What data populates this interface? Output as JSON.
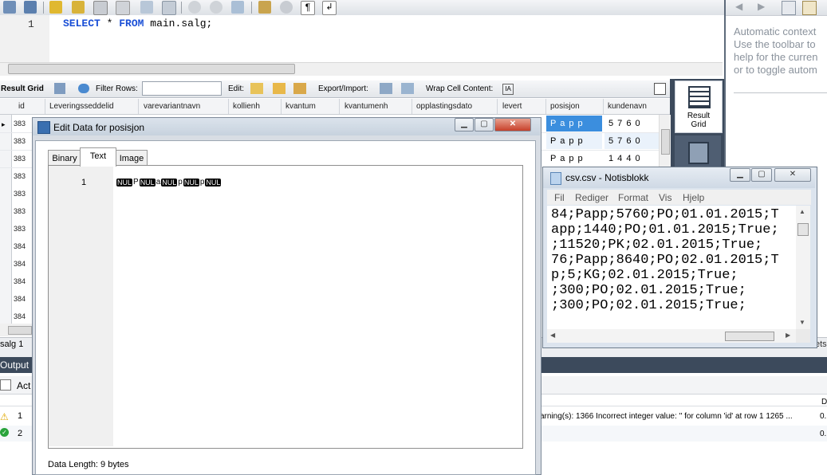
{
  "editor": {
    "line_number": "1",
    "kw_select": "SELECT",
    "star": "*",
    "kw_from": "FROM",
    "table": "main.salg;"
  },
  "help_panel": {
    "lines": [
      "Automatic context",
      "Use the toolbar to",
      "help for the curren",
      "or to toggle autom"
    ]
  },
  "grid_toolbar": {
    "result_grid": "Result Grid",
    "filter_rows": "Filter Rows:",
    "edit": "Edit:",
    "export_import": "Export/Import:",
    "wrap_cell": "Wrap Cell Content:"
  },
  "side_buttons": {
    "result_grid_line1": "Result",
    "result_grid_line2": "Grid"
  },
  "grid": {
    "columns": [
      "id",
      "Leveringsseddelid",
      "varevariantnavn",
      "kollienh",
      "kvantum",
      "kvantumenh",
      "opplastingsdato",
      "levert",
      "posisjon",
      "kundenavn"
    ],
    "row_ids": [
      "383",
      "383",
      "383",
      "383",
      "383",
      "383",
      "383",
      "384",
      "384",
      "384",
      "384",
      "384"
    ],
    "posisjon": [
      "P a p p",
      "P a p p",
      "P a p p"
    ],
    "kundenavn": [
      "5 7 6 0",
      "5 7 6 0",
      "1 4 4 0"
    ]
  },
  "result_tab": "salg 1",
  "bottom": {
    "tab_right": "ets",
    "output_label": "Output",
    "action_label": "Act",
    "rows": [
      {
        "num": "1",
        "msg": "arning(s): 1366 Incorrect integer value: '' for column 'id' at row 1 1265 ...",
        "dur": "0."
      },
      {
        "num": "2",
        "msg": "",
        "dur": "0."
      }
    ],
    "dur_header": "D"
  },
  "dialog": {
    "title": "Edit Data for posisjon",
    "tabs": [
      "Binary",
      "Text",
      "Image"
    ],
    "active_tab": "Text",
    "line_number": "1",
    "content": {
      "nul": "NUL",
      "chars": [
        "P",
        "a",
        "p",
        "p"
      ]
    },
    "data_length": "Data Length: 9 bytes"
  },
  "notepad": {
    "title": "csv.csv - Notisblokk",
    "menu": [
      "Fil",
      "Rediger",
      "Format",
      "Vis",
      "Hjelp"
    ],
    "lines": [
      "84;Papp;5760;PO;01.01.2015;T",
      "app;1440;PO;01.01.2015;True;",
      ";11520;PK;02.01.2015;True;",
      "76;Papp;8640;PO;02.01.2015;T",
      "p;5;KG;02.01.2015;True;",
      ";300;PO;02.01.2015;True;",
      ";300;PO;02.01.2015;True;"
    ]
  },
  "colors": {
    "keyword": "#1a4fd6",
    "dark_panel": "#3c4a5c",
    "selection": "#3b8ede"
  }
}
